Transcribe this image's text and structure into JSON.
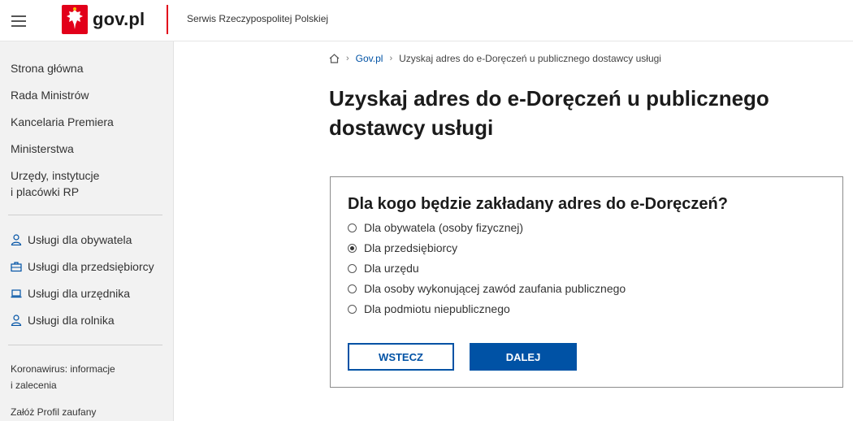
{
  "header": {
    "logo_text": "gov.pl",
    "subtitle": "Serwis Rzeczypospolitej Polskiej",
    "menu_icon": "hamburger-menu-icon",
    "emblem_icon": "polish-eagle-emblem",
    "accent_color": "#e2001a"
  },
  "sidebar": {
    "nav_items": [
      "Strona główna",
      "Rada Ministrów",
      "Kancelaria Premiera",
      "Ministerstwa",
      "Urzędy, instytucje",
      "i placówki RP"
    ],
    "services": [
      {
        "label": "Usługi dla obywatela",
        "icon": "person-icon"
      },
      {
        "label": "Usługi dla przedsiębiorcy",
        "icon": "briefcase-icon"
      },
      {
        "label": "Usługi dla urzędnika",
        "icon": "laptop-icon"
      },
      {
        "label": "Usługi dla rolnika",
        "icon": "person-icon"
      }
    ],
    "extra_links": [
      "Koronawirus: informacje",
      "i zalecenia",
      "Załóż Profil zaufany"
    ]
  },
  "breadcrumb": {
    "home_icon": "home-icon",
    "items": [
      "Gov.pl",
      "Uzyskaj adres do e-Doręczeń u publicznego dostawcy usługi"
    ]
  },
  "page": {
    "title_line1": "Uzyskaj adres do e-Doręczeń u publicznego",
    "title_line2": "dostawcy usługi"
  },
  "form": {
    "question": "Dla kogo będzie zakładany adres do e-Doręczeń?",
    "options": [
      {
        "label": "Dla obywatela (osoby fizycznej)",
        "checked": false
      },
      {
        "label": "Dla przedsiębiorcy",
        "checked": true
      },
      {
        "label": "Dla urzędu",
        "checked": false
      },
      {
        "label": "Dla osoby wykonującej zawód zaufania publicznego",
        "checked": false
      },
      {
        "label": "Dla podmiotu niepublicznego",
        "checked": false
      }
    ],
    "back_label": "WSTECZ",
    "next_label": "DALEJ",
    "primary_color": "#0052a5"
  }
}
